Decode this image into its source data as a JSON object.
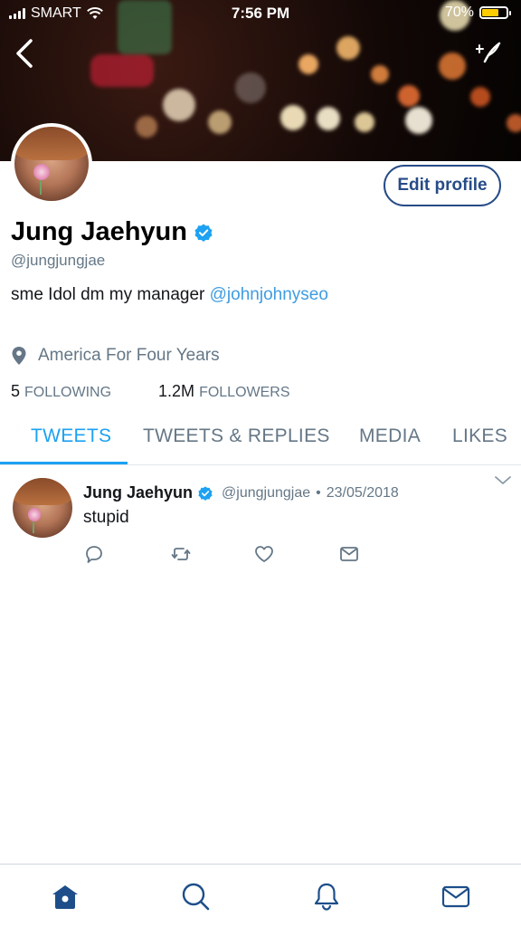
{
  "status_bar": {
    "carrier": "SMART",
    "time": "7:56 PM",
    "battery_percent": "70%",
    "battery_level": 0.7,
    "battery_color": "#ffcc00"
  },
  "header": {
    "back_icon": "chevron-left-icon",
    "compose_icon": "sparkle-feather-icon"
  },
  "profile": {
    "edit_button_label": "Edit profile",
    "display_name": "Jung Jaehyun",
    "handle": "@jungjungjae",
    "bio_text": "sme Idol dm my manager ",
    "bio_mention": "@johnjohnyseo",
    "location": "America For Four Years",
    "following_count": "5",
    "following_label": "FOLLOWING",
    "followers_count": "1.2M",
    "followers_label": "FOLLOWERS"
  },
  "tabs": [
    {
      "label": "TWEETS",
      "active": true
    },
    {
      "label": "TWEETS & REPLIES",
      "active": false
    },
    {
      "label": "MEDIA",
      "active": false
    },
    {
      "label": "LIKES",
      "active": false
    }
  ],
  "tweet": {
    "name": "Jung Jaehyun",
    "handle": "@jungjungjae",
    "separator": "•",
    "date": "23/05/2018",
    "text": "stupid"
  },
  "bottom_nav": {
    "items": [
      "home-icon",
      "search-icon",
      "notifications-bell-icon",
      "messages-envelope-icon"
    ],
    "active_color": "#1d4e89"
  },
  "colors": {
    "accent": "#1da1f2",
    "mention": "#3f9ce1",
    "edit_border": "#274b88",
    "secondary_text": "#657786"
  }
}
